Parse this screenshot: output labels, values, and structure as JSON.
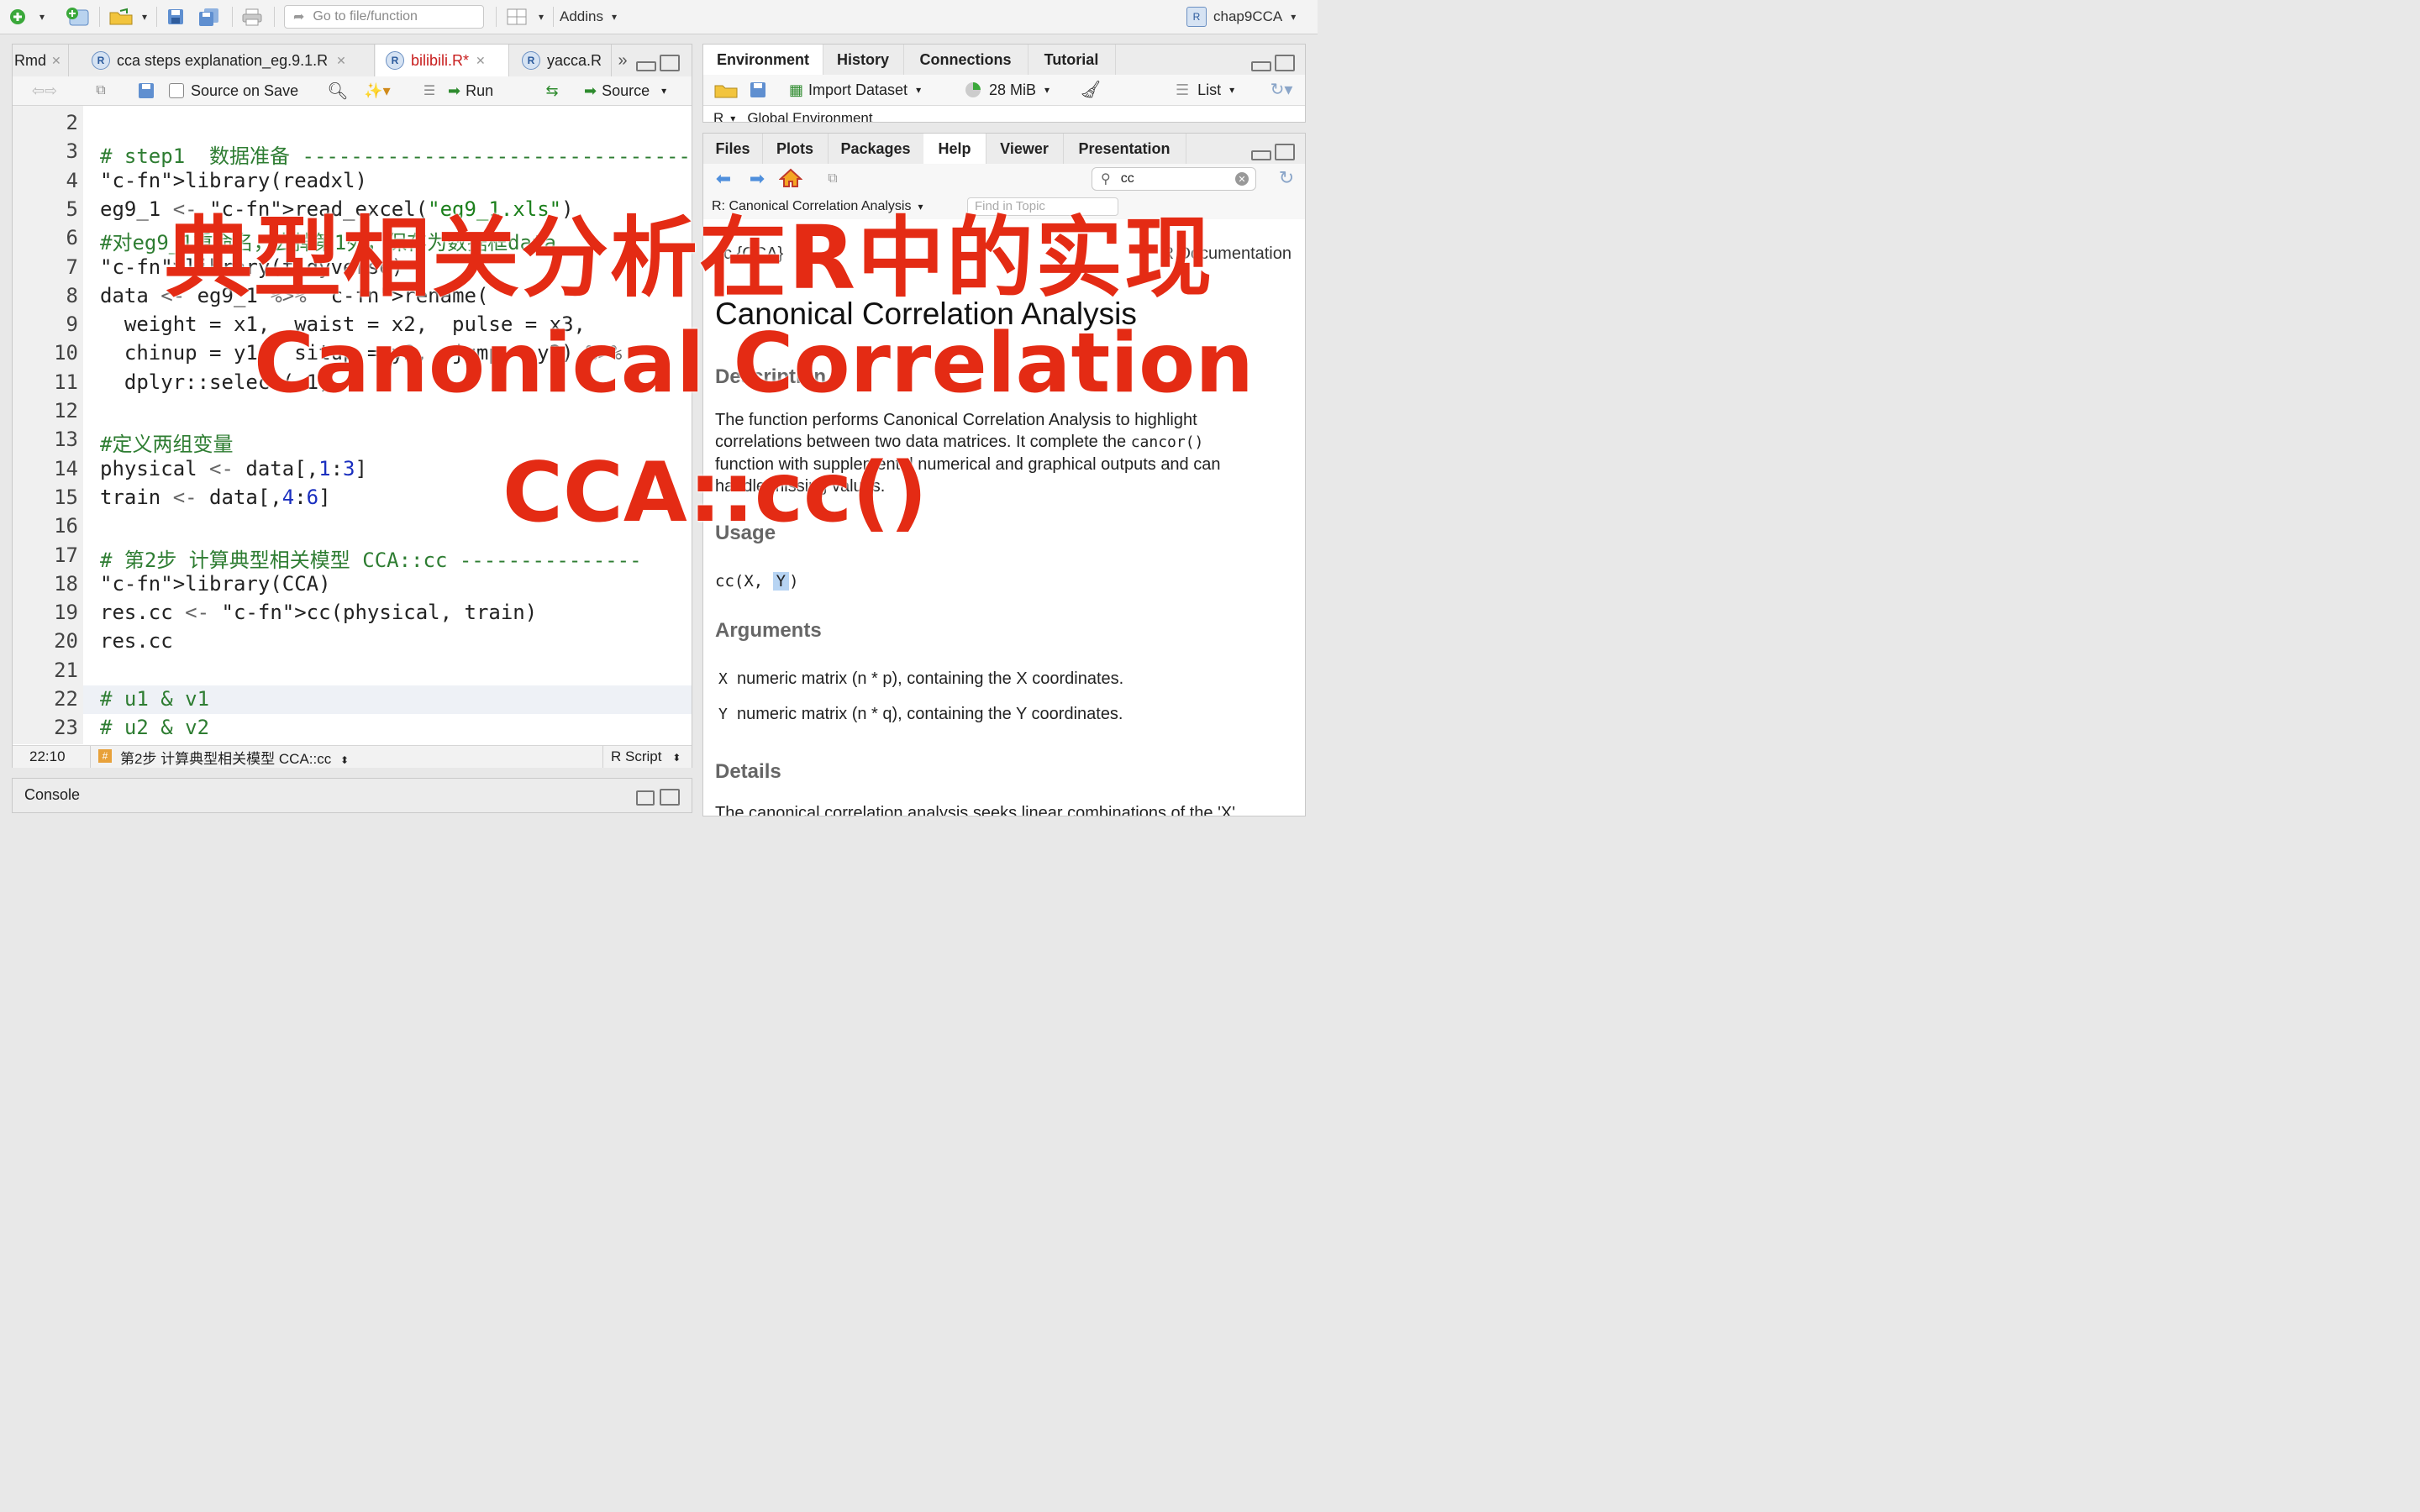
{
  "toolbar": {
    "goto_placeholder": "Go to file/function",
    "addins": "Addins",
    "project": "chap9CCA"
  },
  "editor": {
    "tabs": [
      "Rmd",
      "cca steps explanation_eg.9.1.R",
      "bilibili.R*",
      "yacca.R"
    ],
    "source_on_save": "Source on Save",
    "run": "Run",
    "source": "Source",
    "lines": [
      {
        "n": "2",
        "t": ""
      },
      {
        "n": "3",
        "t": "# step1  数据准备 ------------------------------------"
      },
      {
        "n": "4",
        "t": "library(readxl)"
      },
      {
        "n": "5",
        "t": "eg9_1 <- read_excel(\"eg9_1.xls\")"
      },
      {
        "n": "6",
        "t": "#对eg9_1重命名，去掉第1列，保存为数据框data"
      },
      {
        "n": "7",
        "t": "library(tidyverse)"
      },
      {
        "n": "8",
        "t": "data <- eg9_1 %>% rename("
      },
      {
        "n": "9",
        "t": "  weight = x1,  waist = x2,  pulse = x3,"
      },
      {
        "n": "10",
        "t": "  chinup = y1,  situp = y2,  jump = y3) %>%"
      },
      {
        "n": "11",
        "t": "  dplyr::select(-1)"
      },
      {
        "n": "12",
        "t": ""
      },
      {
        "n": "13",
        "t": "#定义两组变量"
      },
      {
        "n": "14",
        "t": "physical <- data[,1:3]"
      },
      {
        "n": "15",
        "t": "train <- data[,4:6]"
      },
      {
        "n": "16",
        "t": ""
      },
      {
        "n": "17",
        "t": "# 第2步 计算典型相关模型 CCA::cc ---------------"
      },
      {
        "n": "18",
        "t": "library(CCA)"
      },
      {
        "n": "19",
        "t": "res.cc <- cc(physical, train)"
      },
      {
        "n": "20",
        "t": "res.cc"
      },
      {
        "n": "21",
        "t": ""
      },
      {
        "n": "22",
        "t": "# u1 & v1"
      },
      {
        "n": "23",
        "t": "# u2 & v2"
      }
    ],
    "status_pos": "22:10",
    "status_section": "第2步 计算典型相关模型 CCA::cc",
    "status_type": "R Script"
  },
  "console": {
    "title": "Console"
  },
  "env": {
    "tabs": [
      "Environment",
      "History",
      "Connections",
      "Tutorial"
    ],
    "import": "Import Dataset",
    "mem": "28 MiB",
    "list": "List",
    "scope": "Global Environment"
  },
  "files": {
    "tabs": [
      "Files",
      "Plots",
      "Packages",
      "Help",
      "Viewer",
      "Presentation"
    ],
    "search": "cc",
    "topic": "R: Canonical Correlation Analysis",
    "find_placeholder": "Find in Topic"
  },
  "help": {
    "pkgline_left": "cc {CCA}",
    "pkgline_right": "R Documentation",
    "title": "Canonical Correlation Analysis",
    "desc_h": "Description",
    "desc_1": "The function performs Canonical Correlation Analysis to highlight",
    "desc_2a": "correlations between two data matrices. It complete the ",
    "desc_2code": "cancor()",
    "desc_3": "function with supplemental numerical and graphical outputs and can",
    "desc_4": "handle missing values.",
    "usage_h": "Usage",
    "usage_code": "cc(X, Y)",
    "args_h": "Arguments",
    "arg_x_name": "X",
    "arg_x": "numeric matrix (n * p), containing the X coordinates.",
    "arg_y_name": "Y",
    "arg_y": "numeric matrix (n * q), containing the Y coordinates.",
    "details_h": "Details",
    "details_1": "The canonical correlation analysis seeks linear combinations of the 'X'"
  },
  "overlay": {
    "line1": "典型相关分析在R中的实现",
    "line2": "Canonical Correlation",
    "line3": "CCA::cc()"
  },
  "colors": {
    "overlay": "#e42b14",
    "comment": "#2e7d32",
    "keyword": "#0a3a8c"
  }
}
